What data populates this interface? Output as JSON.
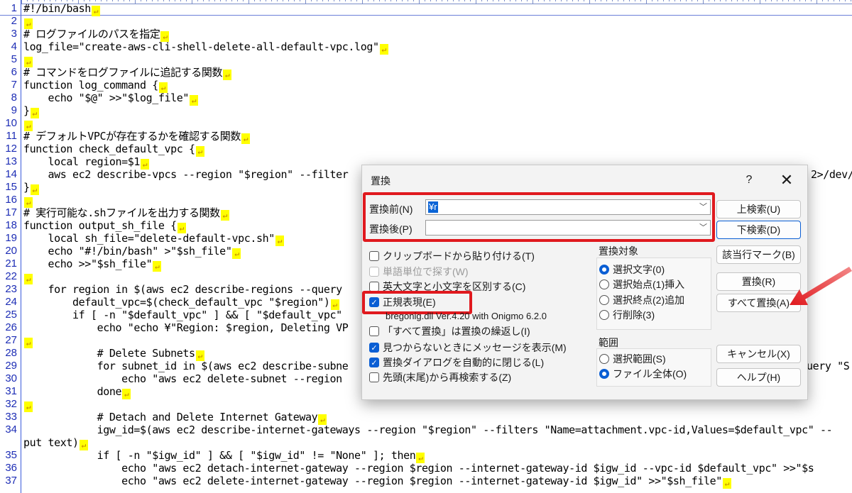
{
  "editor": {
    "lines": [
      {
        "n": "1",
        "t": "#!/bin/bash",
        "eol": true
      },
      {
        "n": "2",
        "t": "",
        "eol": true
      },
      {
        "n": "3",
        "t": "# ログファイルのパスを指定",
        "eol": true
      },
      {
        "n": "4",
        "t": "log_file=\"create-aws-cli-shell-delete-all-default-vpc.log\"",
        "eol": true
      },
      {
        "n": "5",
        "t": "",
        "eol": true
      },
      {
        "n": "6",
        "t": "# コマンドをログファイルに追記する関数",
        "eol": true
      },
      {
        "n": "7",
        "t": "function log_command {",
        "eol": true
      },
      {
        "n": "8",
        "t": "    echo \"$@\" >>\"$log_file\"",
        "eol": true
      },
      {
        "n": "9",
        "t": "}",
        "eol": true
      },
      {
        "n": "10",
        "t": "",
        "eol": true
      },
      {
        "n": "11",
        "t": "# デフォルトVPCが存在するかを確認する関数",
        "eol": true
      },
      {
        "n": "12",
        "t": "function check_default_vpc {",
        "eol": true
      },
      {
        "n": "13",
        "t": "    local region=$1",
        "eol": true
      },
      {
        "n": "14",
        "t": "    aws ec2 describe-vpcs --region \"$region\" --filter",
        "tail": "2>/dev/",
        "eol": false
      },
      {
        "n": "15",
        "t": "}",
        "eol": true
      },
      {
        "n": "16",
        "t": "",
        "eol": true
      },
      {
        "n": "17",
        "t": "# 実行可能な.shファイルを出力する関数",
        "eol": true
      },
      {
        "n": "18",
        "t": "function output_sh_file {",
        "eol": true
      },
      {
        "n": "19",
        "t": "    local sh_file=\"delete-default-vpc.sh\"",
        "eol": true
      },
      {
        "n": "20",
        "t": "    echo \"#!/bin/bash\" >\"$sh_file\"",
        "eol": true
      },
      {
        "n": "21",
        "t": "    echo >>\"$sh_file\"",
        "eol": true
      },
      {
        "n": "22",
        "t": "",
        "eol": true
      },
      {
        "n": "23",
        "t": "    for region in $(aws ec2 describe-regions --query",
        "eol": false
      },
      {
        "n": "24",
        "t": "        default_vpc=$(check_default_vpc \"$region\")",
        "eol": true
      },
      {
        "n": "25",
        "t": "        if [ -n \"$default_vpc\" ] && [ \"$default_vpc\"",
        "eol": false
      },
      {
        "n": "26",
        "t": "            echo \"echo ¥\"Region: $region, Deleting VP",
        "eol": false
      },
      {
        "n": "27",
        "t": "",
        "eol": true
      },
      {
        "n": "28",
        "t": "            # Delete Subnets",
        "eol": true
      },
      {
        "n": "29",
        "t": "            for subnet_id in $(aws ec2 describe-subne",
        "tail": "uery \"S",
        "eol": false
      },
      {
        "n": "30",
        "t": "                echo \"aws ec2 delete-subnet --region",
        "eol": false
      },
      {
        "n": "31",
        "t": "            done",
        "eol": true
      },
      {
        "n": "32",
        "t": "",
        "eol": true
      },
      {
        "n": "33",
        "t": "            # Detach and Delete Internet Gateway",
        "eol": true
      },
      {
        "n": "34",
        "t": "            igw_id=$(aws ec2 describe-internet-gateways --region \"$region\" --filters \"Name=attachment.vpc-id,Values=$default_vpc\" --",
        "eol": false
      },
      {
        "n": "",
        "t": "put text)",
        "eol": true
      },
      {
        "n": "35",
        "t": "            if [ -n \"$igw_id\" ] && [ \"$igw_id\" != \"None\" ]; then",
        "eol": true
      },
      {
        "n": "36",
        "t": "                echo \"aws ec2 detach-internet-gateway --region $region --internet-gateway-id $igw_id --vpc-id $default_vpc\" >>\"$s",
        "eol": false
      },
      {
        "n": "37",
        "t": "                echo \"aws ec2 delete-internet-gateway --region $region --internet-gateway-id $igw_id\" >>\"$sh_file\"",
        "eol": true
      }
    ]
  },
  "dialog": {
    "title": "置換",
    "help": "?",
    "close": "✕",
    "find_label": "置換前(N)",
    "find_value": "¥r",
    "replace_label": "置換後(P)",
    "replace_value": "",
    "options": {
      "clipboard": "クリップボードから貼り付ける(T)",
      "word": "単語単位で探す(W)",
      "case": "英大文字と小文字を区別する(C)",
      "regex": "正規表現(E)",
      "regex_note": "bregonig.dll Ver.4.20 with Onigmo 6.2.0",
      "repeat": "「すべて置換」は置換の繰返し(I)",
      "notfound": "見つからないときにメッセージを表示(M)",
      "autoclose": "置換ダイアログを自動的に閉じる(L)",
      "research": "先頭(末尾)から再検索する(Z)"
    },
    "target_title": "置換対象",
    "targets": [
      "選択文字(0)",
      "選択始点(1)挿入",
      "選択終点(2)追加",
      "行削除(3)"
    ],
    "range_title": "範囲",
    "ranges": [
      "選択範囲(S)",
      "ファイル全体(O)"
    ],
    "buttons": {
      "up": "上検索(U)",
      "down": "下検索(D)",
      "mark": "該当行マーク(B)",
      "replace": "置換(R)",
      "replace_all": "すべて置換(A)",
      "cancel": "キャンセル(X)",
      "help": "ヘルプ(H)"
    }
  },
  "colors": {
    "highlight": "#e0191e",
    "accent": "#0a5ed4",
    "eol": "#ffff00"
  }
}
